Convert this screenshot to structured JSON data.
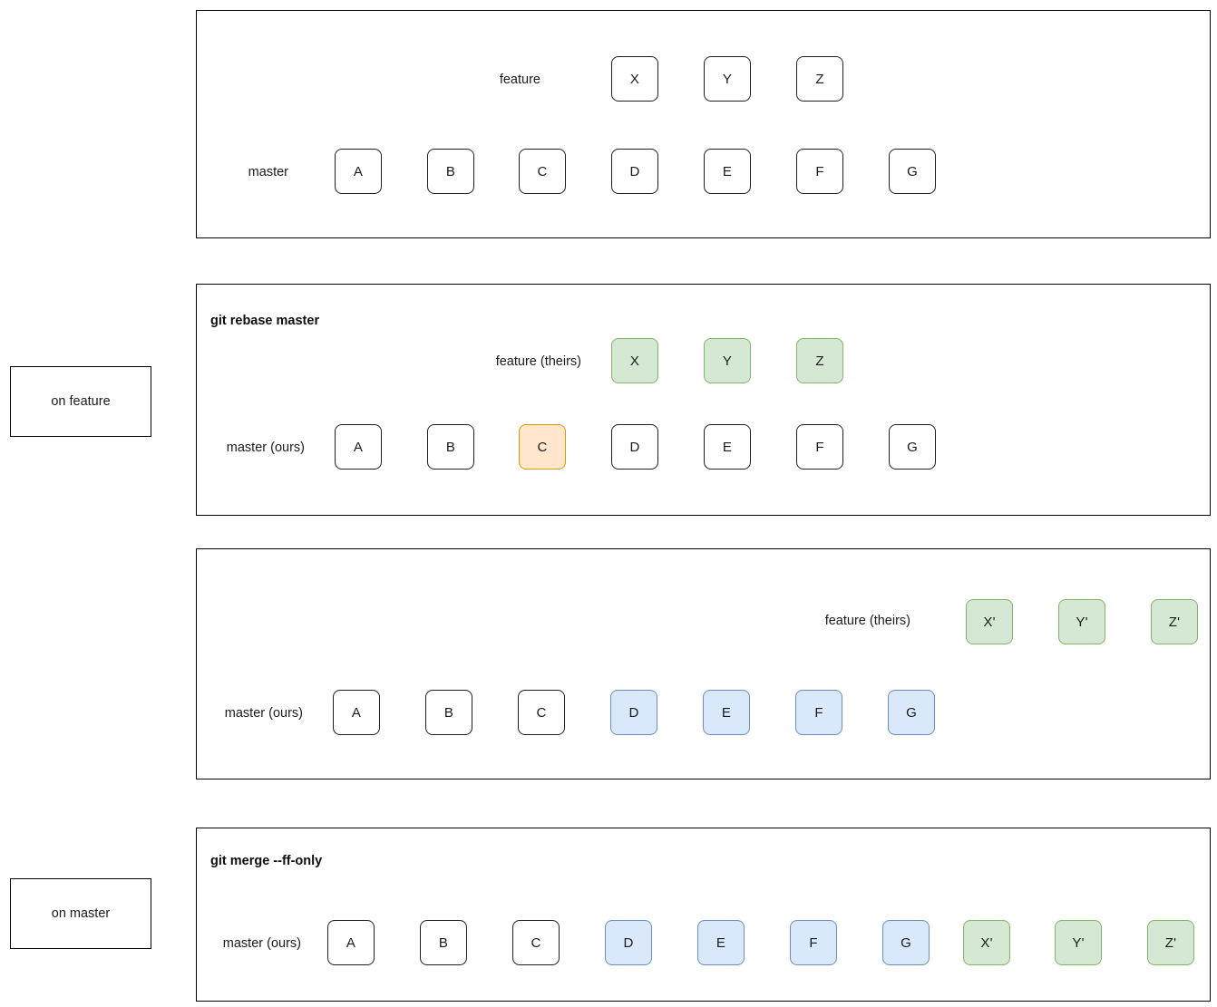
{
  "diagram": {
    "title_semantics": "git rebase then fast-forward merge commit graph",
    "colors": {
      "green_fill": "#d5e8d4",
      "green_stroke": "#82b366",
      "blue_fill": "#dae8fc",
      "blue_stroke": "#6c8ebf",
      "orange_fill": "#ffe6cc",
      "orange_stroke": "#d79b00",
      "default_fill": "#ffffff",
      "default_stroke": "#1f1f1f",
      "panel_border": "#000000"
    }
  },
  "state_boxes": [
    {
      "label": "on feature"
    },
    {
      "label": "on master"
    }
  ],
  "panels": [
    {
      "id": "initial",
      "command": "",
      "branch_labels": [
        {
          "text": "feature"
        },
        {
          "text": "master"
        }
      ],
      "feature_row": [
        {
          "id": "X",
          "label": "X",
          "style": "default"
        },
        {
          "id": "Y",
          "label": "Y",
          "style": "default"
        },
        {
          "id": "Z",
          "label": "Z",
          "style": "default"
        }
      ],
      "master_row": [
        {
          "id": "A",
          "label": "A",
          "style": "default"
        },
        {
          "id": "B",
          "label": "B",
          "style": "default"
        },
        {
          "id": "C",
          "label": "C",
          "style": "default"
        },
        {
          "id": "D",
          "label": "D",
          "style": "default"
        },
        {
          "id": "E",
          "label": "E",
          "style": "default"
        },
        {
          "id": "F",
          "label": "F",
          "style": "default"
        },
        {
          "id": "G",
          "label": "G",
          "style": "default"
        }
      ],
      "branch_pointer": {
        "from": "X",
        "to": "C",
        "color": "#1f1f1f"
      }
    },
    {
      "id": "rebase",
      "command": "git rebase master",
      "branch_labels": [
        {
          "text": "feature (theirs)"
        },
        {
          "text": "master (ours)"
        }
      ],
      "feature_row": [
        {
          "id": "X",
          "label": "X",
          "style": "green"
        },
        {
          "id": "Y",
          "label": "Y",
          "style": "green"
        },
        {
          "id": "Z",
          "label": "Z",
          "style": "green"
        }
      ],
      "master_row": [
        {
          "id": "A",
          "label": "A",
          "style": "default"
        },
        {
          "id": "B",
          "label": "B",
          "style": "default"
        },
        {
          "id": "C",
          "label": "C",
          "style": "orange"
        },
        {
          "id": "D",
          "label": "D",
          "style": "default"
        },
        {
          "id": "E",
          "label": "E",
          "style": "default"
        },
        {
          "id": "F",
          "label": "F",
          "style": "default"
        },
        {
          "id": "G",
          "label": "G",
          "style": "default"
        }
      ]
    },
    {
      "id": "rebased",
      "command": "",
      "branch_labels": [
        {
          "text": "feature (theirs)"
        },
        {
          "text": "master (ours)"
        }
      ],
      "feature_row": [
        {
          "id": "Xp",
          "label": "X'",
          "style": "green"
        },
        {
          "id": "Yp",
          "label": "Y'",
          "style": "green"
        },
        {
          "id": "Zp",
          "label": "Z'",
          "style": "green"
        }
      ],
      "master_row": [
        {
          "id": "A",
          "label": "A",
          "style": "default"
        },
        {
          "id": "B",
          "label": "B",
          "style": "default"
        },
        {
          "id": "C",
          "label": "C",
          "style": "default"
        },
        {
          "id": "D",
          "label": "D",
          "style": "blue"
        },
        {
          "id": "E",
          "label": "E",
          "style": "blue"
        },
        {
          "id": "F",
          "label": "F",
          "style": "blue"
        },
        {
          "id": "G",
          "label": "G",
          "style": "blue"
        }
      ],
      "branch_pointer": {
        "from": "X'",
        "to": "G",
        "color": "#1f1f1f"
      }
    },
    {
      "id": "ffmerge",
      "command": "git merge --ff-only",
      "branch_labels": [
        {
          "text": "master (ours)"
        }
      ],
      "master_row": [
        {
          "id": "A",
          "label": "A",
          "style": "default"
        },
        {
          "id": "B",
          "label": "B",
          "style": "default"
        },
        {
          "id": "C",
          "label": "C",
          "style": "default"
        },
        {
          "id": "D",
          "label": "D",
          "style": "blue"
        },
        {
          "id": "E",
          "label": "E",
          "style": "blue"
        },
        {
          "id": "F",
          "label": "F",
          "style": "blue"
        },
        {
          "id": "G",
          "label": "G",
          "style": "blue"
        },
        {
          "id": "Xp",
          "label": "X'",
          "style": "green"
        },
        {
          "id": "Yp",
          "label": "Y'",
          "style": "green"
        },
        {
          "id": "Zp",
          "label": "Z'",
          "style": "green"
        }
      ]
    }
  ]
}
